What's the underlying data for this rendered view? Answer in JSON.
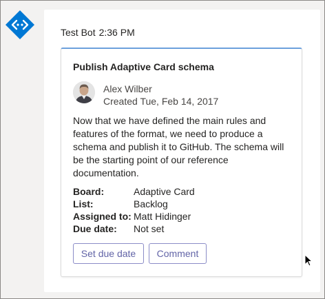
{
  "message": {
    "sender": "Test Bot",
    "time": "2:36 PM"
  },
  "card": {
    "title": "Publish Adaptive Card schema",
    "author_name": "Alex Wilber",
    "created": "Created Tue, Feb 14, 2017",
    "description": "Now that we have defined the main rules and features of the format, we need to produce a schema and publish it to GitHub. The schema will be the starting point of our reference documentation.",
    "facts": [
      {
        "key": "Board:",
        "value": "Adaptive Card"
      },
      {
        "key": "List:",
        "value": "Backlog"
      },
      {
        "key": "Assigned to:",
        "value": "Matt Hidinger"
      },
      {
        "key": "Due date:",
        "value": "Not set"
      }
    ],
    "actions": {
      "due_label": "Set due date",
      "comment_label": "Comment"
    }
  },
  "colors": {
    "bot_avatar": "#0078d4",
    "card_accent": "#6ca0dc",
    "action_text": "#6264a7"
  },
  "icons": {
    "bot_avatar": "diamond-code-icon",
    "cursor": "mouse-pointer-icon"
  }
}
